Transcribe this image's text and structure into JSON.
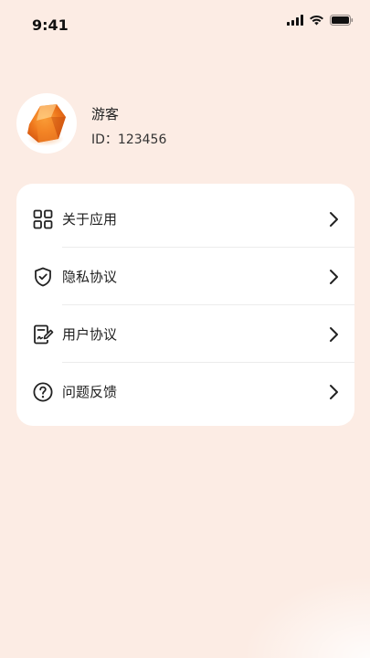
{
  "status_bar": {
    "time": "9:41",
    "icons": [
      "signal-icon",
      "wifi-icon",
      "battery-icon"
    ]
  },
  "profile": {
    "nickname": "游客",
    "id_text": "ID：123456",
    "avatar_icon": "orange-gem-avatar"
  },
  "menu": {
    "items": [
      {
        "label": "关于应用",
        "icon": "grid-apps-icon"
      },
      {
        "label": "隐私协议",
        "icon": "shield-check-icon"
      },
      {
        "label": "用户协议",
        "icon": "document-sign-icon"
      },
      {
        "label": "问题反馈",
        "icon": "question-circle-icon"
      }
    ]
  },
  "colors": {
    "background": "#fcece4",
    "card": "#ffffff",
    "text": "#1f1f1f",
    "avatar_accent": "#f07a1e"
  }
}
